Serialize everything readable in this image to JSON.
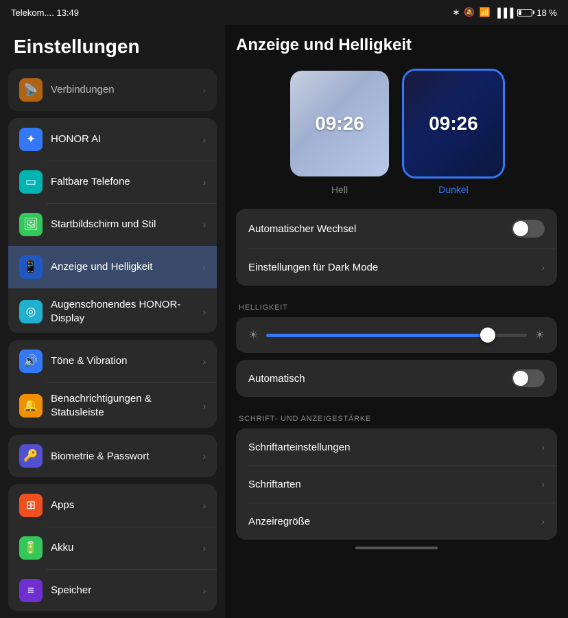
{
  "statusBar": {
    "carrier": "Telekom.... 13:49",
    "batteryPercent": "18 %"
  },
  "sidebar": {
    "title": "Einstellungen",
    "partialItem": {
      "label": "Verbindungen"
    },
    "groups": [
      {
        "id": "group1",
        "items": [
          {
            "id": "honor-ai",
            "label": "HONOR AI",
            "iconClass": "ic-blue",
            "icon": "✦"
          },
          {
            "id": "foldable",
            "label": "Faltbare Telefone",
            "iconClass": "ic-teal",
            "icon": "📱"
          },
          {
            "id": "homescreen",
            "label": "Startbildschirm und Stil",
            "iconClass": "ic-green",
            "icon": "🖼"
          },
          {
            "id": "display",
            "label": "Anzeige und Helligkeit",
            "iconClass": "ic-darkblue",
            "icon": "📱",
            "active": true
          },
          {
            "id": "eye-comfort",
            "label": "Augenschonendes HONOR-Display",
            "iconClass": "ic-cyan",
            "icon": "👁"
          }
        ]
      },
      {
        "id": "group2",
        "items": [
          {
            "id": "sounds",
            "label": "Töne & Vibration",
            "iconClass": "ic-blue",
            "icon": "🔊"
          },
          {
            "id": "notifications",
            "label": "Benachrichtigungen & Statusleiste",
            "iconClass": "ic-yellow-orange",
            "icon": "🔔"
          }
        ]
      },
      {
        "id": "group3",
        "items": [
          {
            "id": "biometrics",
            "label": "Biometrie & Passwort",
            "iconClass": "ic-indigo",
            "icon": "🔑"
          }
        ]
      },
      {
        "id": "group4",
        "items": [
          {
            "id": "apps",
            "label": "Apps",
            "iconClass": "ic-orange2",
            "icon": "⊞"
          },
          {
            "id": "battery",
            "label": "Akku",
            "iconClass": "ic-green",
            "icon": "🔋"
          },
          {
            "id": "storage",
            "label": "Speicher",
            "iconClass": "ic-purple",
            "icon": "≡"
          }
        ]
      }
    ]
  },
  "rightPanel": {
    "title": "Anzeige und Helligkeit",
    "themeOptions": [
      {
        "id": "light",
        "time": "09:26",
        "label": "Hell",
        "selected": false
      },
      {
        "id": "dark",
        "time": "09:26",
        "label": "Dunkel",
        "selected": true
      }
    ],
    "topSettings": {
      "autoSwitch": {
        "label": "Automatischer Wechsel",
        "toggleState": "off"
      },
      "darkModeSettings": {
        "label": "Einstellungen für Dark Mode"
      }
    },
    "brightness": {
      "sectionLabel": "HELLIGKEIT",
      "sliderValue": 85,
      "autoLabel": "Automatisch",
      "autoToggleState": "off"
    },
    "fontSection": {
      "sectionLabel": "SCHRIFT- UND ANZEIGESTÄRKE",
      "items": [
        {
          "id": "font-settings",
          "label": "Schriftarteinstellungen"
        },
        {
          "id": "fonts",
          "label": "Schriftarten"
        },
        {
          "id": "display-size",
          "label": "Anzeiregröße"
        }
      ]
    }
  }
}
